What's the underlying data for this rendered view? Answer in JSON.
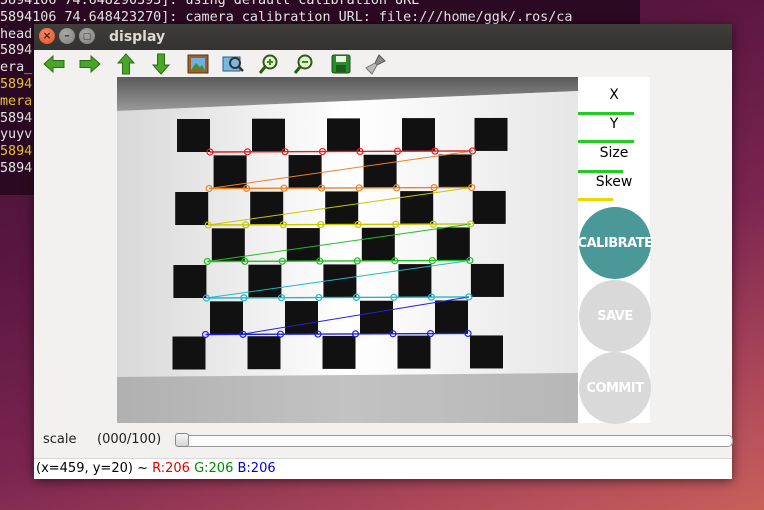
{
  "terminal": {
    "lines": [
      {
        "text": "5894106 74.648290393]: using default calibration URL",
        "hl": false
      },
      {
        "text": "5894106 74.648423270]: camera calibration URL: file:///home/ggk/.ros/ca",
        "hl": false
      },
      {
        "text": "head",
        "hl": false
      },
      {
        "text": "5894",
        "hl": false
      },
      {
        "text": "era_",
        "hl": false
      },
      {
        "text": "5894",
        "hl": true
      },
      {
        "text": "mera",
        "hl": true
      },
      {
        "text": "5894",
        "hl": false
      },
      {
        "text": "yuyv",
        "hl": false
      },
      {
        "text": "5894",
        "hl": true
      },
      {
        "text": "5894",
        "hl": false
      }
    ]
  },
  "window": {
    "title": "display",
    "close_glyph": "×",
    "min_glyph": "–",
    "max_glyph": "▢"
  },
  "toolbar": {
    "icons": [
      "arrow-left-icon",
      "arrow-right-icon",
      "arrow-up-icon",
      "arrow-down-icon",
      "image-icon",
      "fit-window-icon",
      "zoom-in-icon",
      "zoom-out-icon",
      "save-icon",
      "clear-brush-icon"
    ]
  },
  "calibration": {
    "x_label": "X",
    "y_label": "Y",
    "size_label": "Size",
    "skew_label": "Skew",
    "x_progress": 0.78,
    "y_progress": 0.78,
    "size_progress": 0.62,
    "skew_progress": 0.48,
    "colors": {
      "x": "#22cc22",
      "y": "#22cc22",
      "size": "#22cc22",
      "skew": "#e6d800"
    },
    "calibrate_label": "CALIBRATE",
    "save_label": "SAVE",
    "commit_label": "COMMIT",
    "calibrate_color": "#4a9898",
    "disabled_color": "#d9d9d9"
  },
  "scale": {
    "label": "scale",
    "value": "(000/100)",
    "position": 0
  },
  "status": {
    "coords": "(x=459, y=20) ~",
    "r": "R:206",
    "g": "G:206",
    "b": "B:206",
    "r_color": "#e00000",
    "g_color": "#008a00",
    "b_color": "#0000dd"
  },
  "corner_row_colors": [
    "#e02020",
    "#f08020",
    "#c8c800",
    "#20c020",
    "#20b8c8",
    "#2020e0"
  ]
}
